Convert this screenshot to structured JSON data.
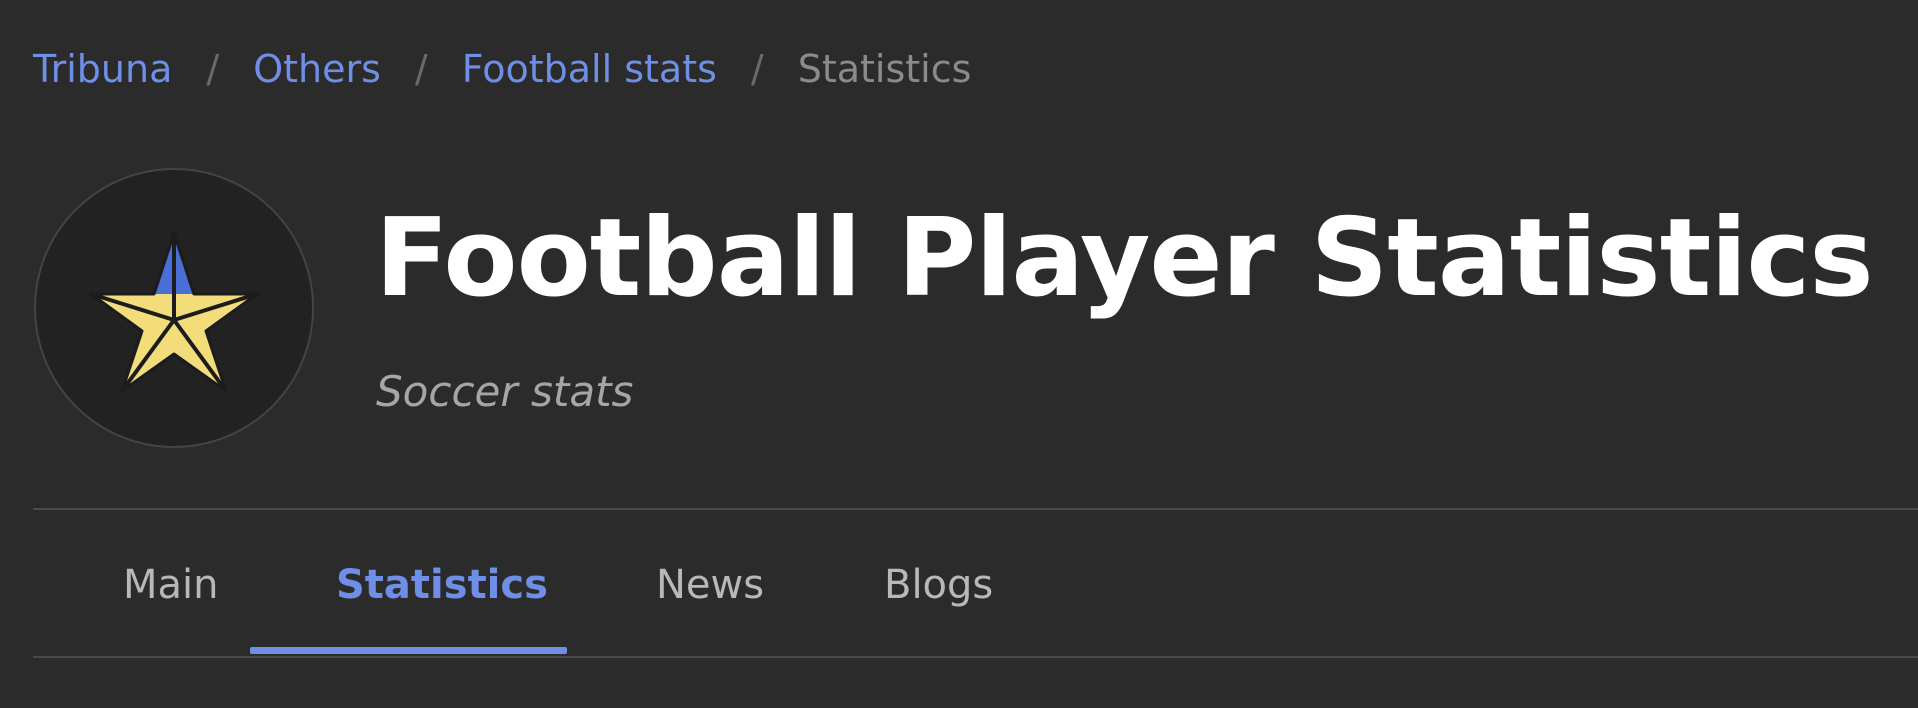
{
  "breadcrumb": {
    "items": [
      {
        "label": "Tribuna"
      },
      {
        "label": "Others"
      },
      {
        "label": "Football stats"
      }
    ],
    "separator": "/",
    "current": "Statistics"
  },
  "header": {
    "logo_icon": "star-icon",
    "title": "Football Player Statistics",
    "subtitle": "Soccer stats"
  },
  "tabs": {
    "items": [
      {
        "label": "Main"
      },
      {
        "label": "Statistics"
      },
      {
        "label": "News"
      },
      {
        "label": "Blogs"
      }
    ],
    "active": "Statistics"
  },
  "colors": {
    "background": "#2b2b2b",
    "link": "#6f8ee6",
    "accent": "#6f8ee6",
    "star_top": "#4a6fd6",
    "star_bottom": "#f2dd7a"
  }
}
